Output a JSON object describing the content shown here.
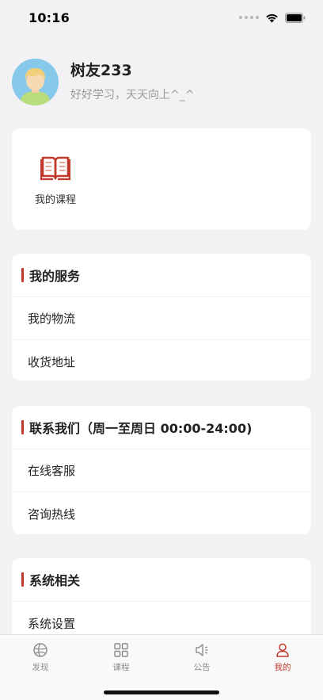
{
  "status_bar": {
    "time": "10:16"
  },
  "profile": {
    "username": "树友233",
    "motto": "好好学习，天天向上^_^"
  },
  "course_card": {
    "label": "我的课程"
  },
  "services": {
    "title": "我的服务",
    "items": [
      {
        "label": "我的物流"
      },
      {
        "label": "收货地址"
      }
    ]
  },
  "contact": {
    "title": "联系我们（周一至周日 00:00-24:00)",
    "items": [
      {
        "label": "在线客服"
      },
      {
        "label": "咨询热线"
      }
    ]
  },
  "system": {
    "title": "系统相关",
    "items": [
      {
        "label": "系统设置"
      }
    ]
  },
  "tabs": [
    {
      "label": "发现",
      "icon": "discover-icon",
      "active": false
    },
    {
      "label": "课程",
      "icon": "grid-icon",
      "active": false
    },
    {
      "label": "公告",
      "icon": "speaker-icon",
      "active": false
    },
    {
      "label": "我的",
      "icon": "person-icon",
      "active": true
    }
  ],
  "colors": {
    "accent": "#c0392b",
    "background": "#f2f2f4",
    "card": "#ffffff"
  }
}
